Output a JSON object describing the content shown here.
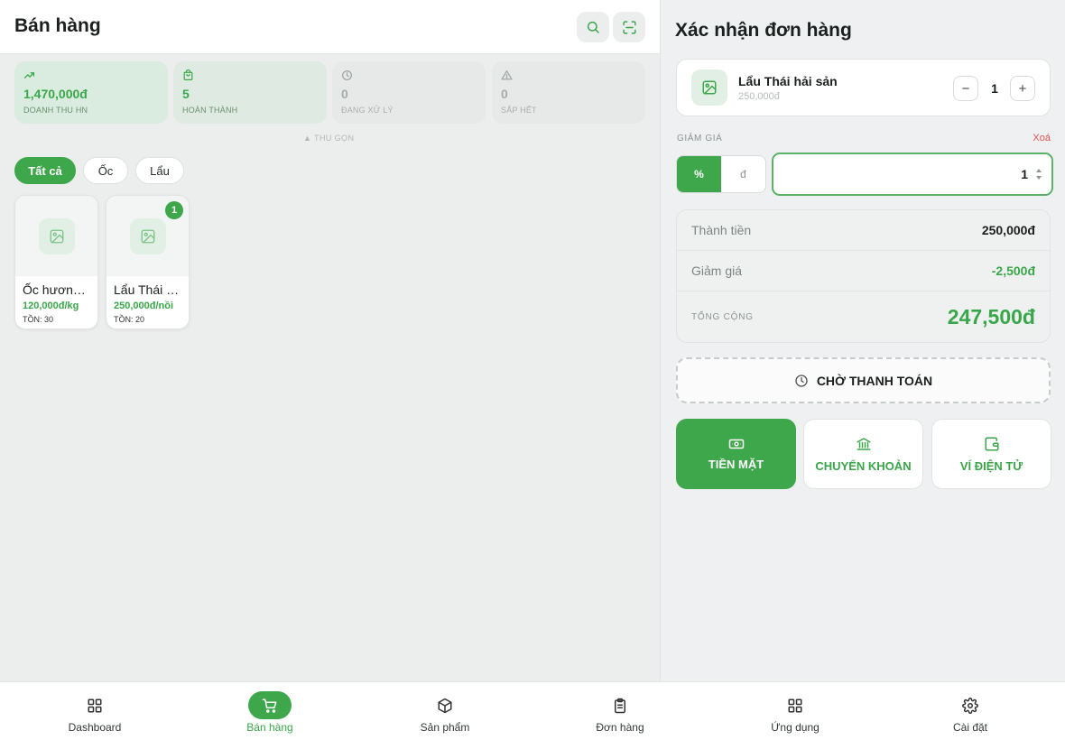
{
  "header": {
    "title": "Bán hàng",
    "search_icon": "search-icon",
    "scan_icon": "scan-icon"
  },
  "stats": [
    {
      "icon": "trend-up-icon",
      "value": "1,470,000đ",
      "label": "DOANH THU HN"
    },
    {
      "icon": "bag-icon",
      "value": "5",
      "label": "HOÀN THÀNH"
    },
    {
      "icon": "clock-icon",
      "value": "0",
      "label": "ĐANG XỬ LÝ"
    },
    {
      "icon": "warning-icon",
      "value": "0",
      "label": "SẮP HẾT"
    }
  ],
  "collapse_label": "▲ THU GỌN",
  "filters": [
    "Tất cả",
    "Ốc",
    "Lẩu"
  ],
  "active_filter": "Tất cả",
  "products": [
    {
      "name": "Ốc hương nướng",
      "price": "120,000đ/kg",
      "stock": "TỒN: 30",
      "badge": ""
    },
    {
      "name": "Lẩu Thái hải sản",
      "price": "250,000đ/nồi",
      "stock": "TỒN: 20",
      "badge": "1"
    }
  ],
  "order": {
    "title": "Xác nhận đơn hàng",
    "item": {
      "name": "Lẩu Thái hải sản",
      "price": "250,000đ",
      "qty": "1",
      "minus": "−",
      "plus": "+"
    },
    "discount": {
      "label": "GIẢM GIÁ",
      "clear": "Xoá",
      "mode_percent": "%",
      "mode_amount": "đ",
      "active_mode": "%",
      "value": "1"
    },
    "summary": {
      "subtotal_label": "Thành tiền",
      "subtotal": "250,000đ",
      "discount_label": "Giảm giá",
      "discount": "-2,500đ",
      "total_label": "TỔNG CỘNG",
      "total": "247,500đ"
    },
    "wait_button": "CHỜ THANH TOÁN",
    "payment_methods": [
      {
        "label": "TIỀN MẶT",
        "icon": "cash-icon"
      },
      {
        "label": "CHUYỂN KHOẢN",
        "icon": "bank-icon"
      },
      {
        "label": "VÍ ĐIỆN TỬ",
        "icon": "wallet-icon"
      }
    ],
    "active_payment": "TIỀN MẶT"
  },
  "nav": [
    {
      "label": "Dashboard",
      "icon": "grid-icon"
    },
    {
      "label": "Bán hàng",
      "icon": "cart-icon"
    },
    {
      "label": "Sản phẩm",
      "icon": "box-icon"
    },
    {
      "label": "Đơn hàng",
      "icon": "clipboard-icon"
    },
    {
      "label": "Ứng dụng",
      "icon": "apps-icon"
    },
    {
      "label": "Cài đặt",
      "icon": "gear-icon"
    }
  ],
  "active_nav": "Bán hàng",
  "colors": {
    "accent": "#3fa74b",
    "accent_text": "#3aa64a",
    "danger": "#e05252"
  }
}
